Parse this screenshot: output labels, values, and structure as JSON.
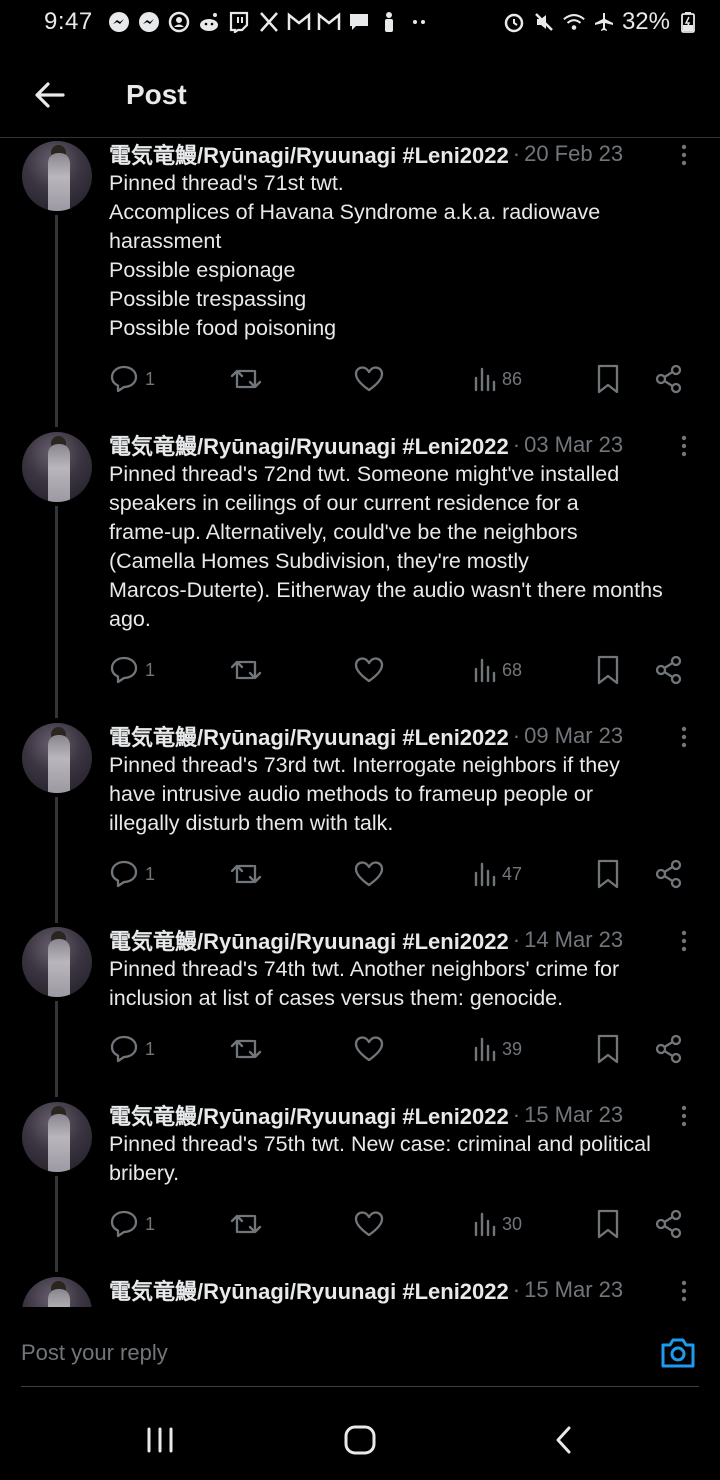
{
  "status_bar": {
    "time": "9:47",
    "battery": "32%",
    "left_icons": [
      "messenger-icon",
      "messenger-icon",
      "account-icon",
      "reddit-icon",
      "twitch-icon",
      "x-icon",
      "gmail-icon",
      "gmail-icon",
      "chat-icon",
      "figure-icon",
      "more-dots-icon"
    ],
    "right_icons": [
      "alarm-icon",
      "mute-icon",
      "wifi-icon",
      "airplane-icon",
      "battery-charging-icon"
    ]
  },
  "header": {
    "title": "Post"
  },
  "posts": [
    {
      "author": "電気竜鰻/Ryūnagi/Ryuunagi #Leni2022",
      "separator": "·",
      "date": "20 Feb 23",
      "lines": [
        "Pinned thread's 71st twt.",
        "Accomplices of Havana Syndrome a.k.a. radiowave",
        "harassment",
        "Possible espionage",
        "Possible trespassing",
        "Possible food poisoning"
      ],
      "replies": "1",
      "views": "86"
    },
    {
      "author": "電気竜鰻/Ryūnagi/Ryuunagi #Leni2022",
      "separator": "·",
      "date": "03 Mar 23",
      "lines": [
        "Pinned thread's 72nd twt. Someone might've installed",
        "speakers in ceilings of our current residence for a",
        "frame-up. Alternatively, could've be the neighbors",
        "(Camella Homes Subdivision, they're mostly",
        "Marcos-Duterte). Eitherway the audio wasn't there months",
        "ago."
      ],
      "replies": "1",
      "views": "68"
    },
    {
      "author": "電気竜鰻/Ryūnagi/Ryuunagi #Leni2022",
      "separator": "·",
      "date": "09 Mar 23",
      "lines": [
        "Pinned thread's 73rd twt. Interrogate neighbors if they",
        "have intrusive audio methods to frameup people or",
        "illegally disturb them with talk."
      ],
      "replies": "1",
      "views": "47"
    },
    {
      "author": "電気竜鰻/Ryūnagi/Ryuunagi #Leni2022",
      "separator": "·",
      "date": "14 Mar 23",
      "lines": [
        "Pinned thread's 74th twt. Another neighbors' crime for",
        "inclusion at list of cases versus them: genocide."
      ],
      "replies": "1",
      "views": "39"
    },
    {
      "author": "電気竜鰻/Ryūnagi/Ryuunagi #Leni2022",
      "separator": "·",
      "date": "15 Mar 23",
      "lines": [
        "Pinned thread's 75th twt. New case: criminal and political",
        "bribery."
      ],
      "replies": "1",
      "views": "30"
    },
    {
      "author": "電気竜鰻/Ryūnagi/Ryuunagi #Leni2022",
      "separator": "·",
      "date": "15 Mar 23",
      "lines": [],
      "replies": "",
      "views": ""
    }
  ],
  "reply_bar": {
    "placeholder": "Post your reply"
  },
  "colors": {
    "accent": "#1d9bf0",
    "muted": "#71767b",
    "text": "#e7e9ea",
    "background": "#000000"
  }
}
